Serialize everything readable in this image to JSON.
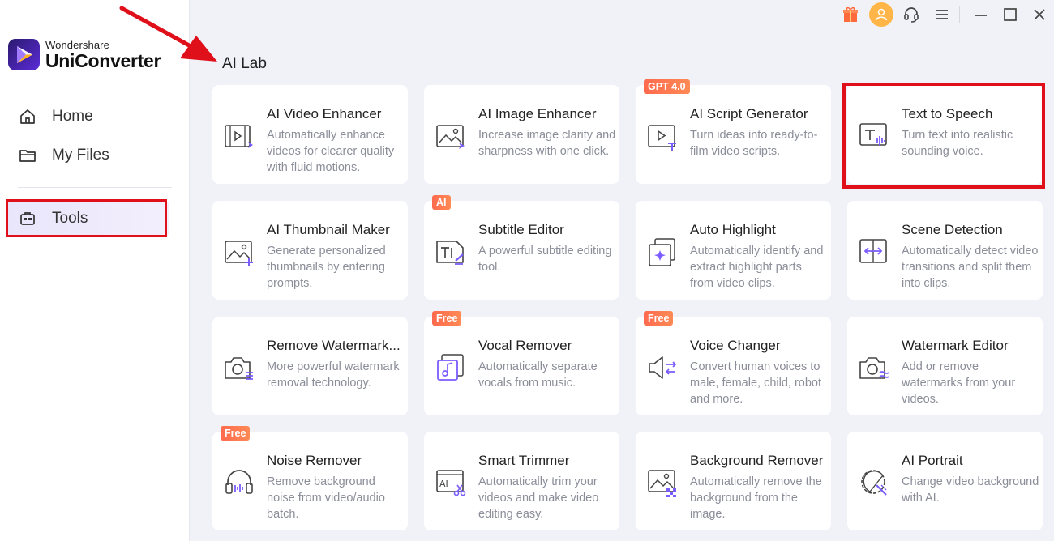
{
  "app": {
    "brand": "Wondershare",
    "product": "UniConverter"
  },
  "sidebar": {
    "items": [
      {
        "label": "Home",
        "icon": "home-icon"
      },
      {
        "label": "My Files",
        "icon": "folder-icon"
      },
      {
        "label": "Tools",
        "icon": "toolbox-icon",
        "active": true
      }
    ]
  },
  "main": {
    "section_title": "AI Lab",
    "cards": [
      {
        "title": "AI Video Enhancer",
        "desc": "Automatically enhance videos for clearer quality with fluid motions.",
        "badge": "",
        "icon": "video-enhance-icon"
      },
      {
        "title": "AI Image Enhancer",
        "desc": "Increase image clarity and sharpness with one click.",
        "badge": "",
        "icon": "image-enhance-icon"
      },
      {
        "title": "AI Script Generator",
        "desc": "Turn ideas into ready-to-film video scripts.",
        "badge": "GPT 4.0",
        "icon": "script-icon"
      },
      {
        "title": "Text to Speech",
        "desc": "Turn text into realistic sounding voice.",
        "badge": "",
        "icon": "text-to-speech-icon",
        "highlighted": true
      },
      {
        "title": "AI Thumbnail Maker",
        "desc": "Generate personalized thumbnails by entering prompts.",
        "badge": "",
        "icon": "thumbnail-icon"
      },
      {
        "title": "Subtitle Editor",
        "desc": "A powerful subtitle editing tool.",
        "badge": "AI",
        "icon": "subtitle-icon"
      },
      {
        "title": "Auto Highlight",
        "desc": "Automatically identify and extract highlight parts from video clips.",
        "badge": "",
        "icon": "highlight-icon"
      },
      {
        "title": "Scene Detection",
        "desc": "Automatically detect video transitions and split them into clips.",
        "badge": "",
        "icon": "scene-icon"
      },
      {
        "title": "Remove Watermark...",
        "desc": "More powerful watermark removal technology.",
        "badge": "",
        "icon": "remove-watermark-icon"
      },
      {
        "title": "Vocal Remover",
        "desc": "Automatically separate vocals from music.",
        "badge": "Free",
        "icon": "vocal-icon"
      },
      {
        "title": "Voice Changer",
        "desc": "Convert human voices to male, female, child, robot and more.",
        "badge": "Free",
        "icon": "voice-icon"
      },
      {
        "title": "Watermark Editor",
        "desc": "Add or remove watermarks from your videos.",
        "badge": "",
        "icon": "watermark-icon"
      },
      {
        "title": "Noise Remover",
        "desc": "Remove background noise from video/audio batch.",
        "badge": "Free",
        "icon": "noise-icon"
      },
      {
        "title": "Smart Trimmer",
        "desc": "Automatically trim your videos and make video editing easy.",
        "badge": "",
        "icon": "trimmer-icon"
      },
      {
        "title": "Background Remover",
        "desc": "Automatically remove the background from the image.",
        "badge": "",
        "icon": "bg-remove-icon"
      },
      {
        "title": "AI Portrait",
        "desc": "Change video background with AI.",
        "badge": "",
        "icon": "portrait-icon"
      }
    ]
  },
  "colors": {
    "accent": "#6d4cf0",
    "highlight_box": "#e0101a",
    "badge": "#ff6a4e",
    "avatar": "#ffb547"
  }
}
